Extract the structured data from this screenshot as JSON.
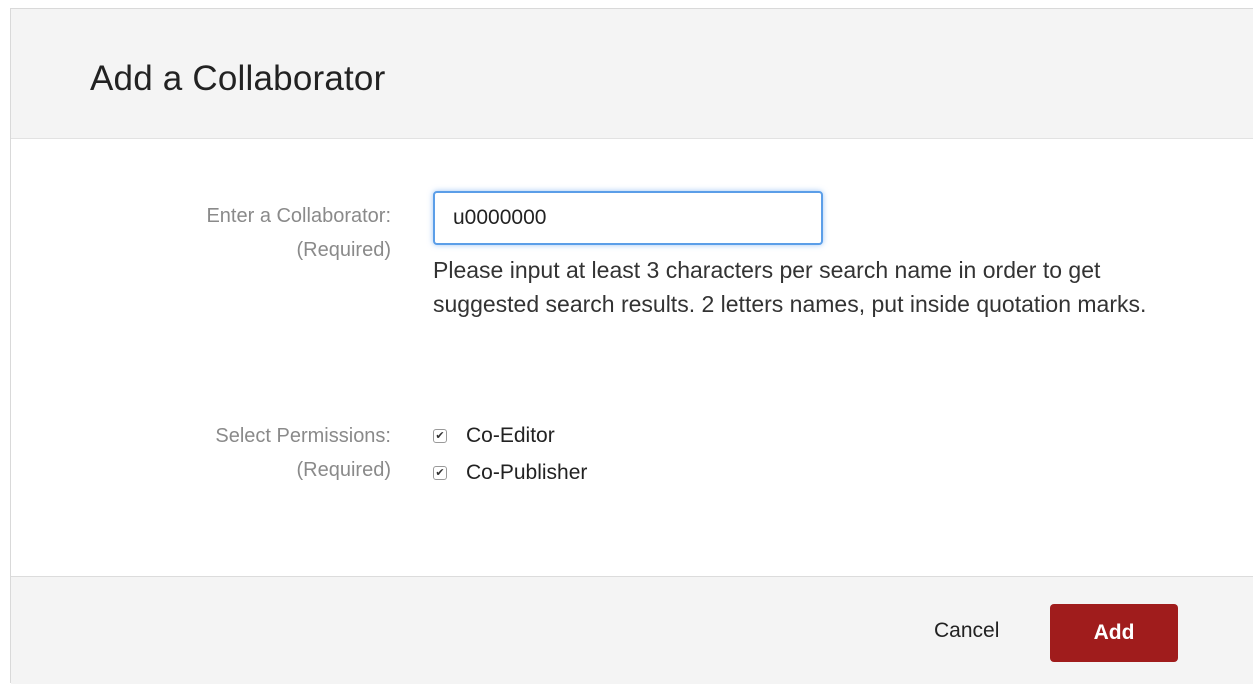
{
  "dialog": {
    "title": "Add a Collaborator"
  },
  "collaborator": {
    "label": "Enter a Collaborator:",
    "required": "(Required)",
    "value": "u0000000",
    "help": "Please input at least 3 characters per search name in order to get suggested search results. 2 letters names, put inside quotation marks."
  },
  "permissions": {
    "label": "Select Permissions:",
    "required": "(Required)",
    "options": [
      {
        "label": "Co-Editor",
        "checked": true
      },
      {
        "label": "Co-Publisher",
        "checked": true
      }
    ]
  },
  "footer": {
    "cancel_label": "Cancel",
    "add_label": "Add"
  },
  "colors": {
    "accent": "#a01c1c",
    "focus": "#5b9ee8"
  }
}
